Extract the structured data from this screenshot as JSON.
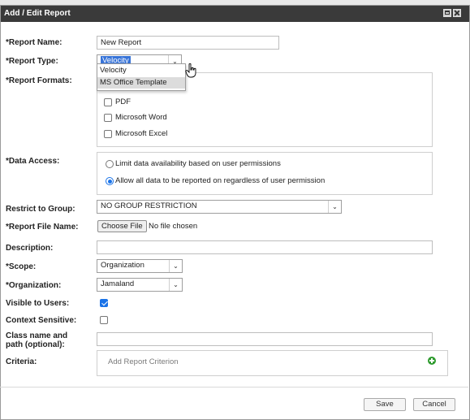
{
  "dialog": {
    "title": "Add / Edit Report"
  },
  "labels": {
    "report_name": "*Report Name:",
    "report_type": "*Report Type:",
    "report_formats": "*Report Formats:",
    "data_access": "*Data Access:",
    "restrict_group": "Restrict to Group:",
    "report_file_name": "*Report File Name:",
    "description": "Description:",
    "scope": "*Scope:",
    "organization": "*Organization:",
    "visible_users": "Visible to Users:",
    "context_sensitive": "Context Sensitive:",
    "class_name_line1": "Class name and",
    "class_name_line2": "path (optional):",
    "criteria": "Criteria:"
  },
  "fields": {
    "report_name_value": "New Report",
    "report_type_value": "Velocity",
    "report_type_options": [
      "Velocity",
      "MS Office Template"
    ],
    "formats": [
      "PDF",
      "Microsoft Word",
      "Microsoft Excel"
    ],
    "data_access_options": [
      "Limit data availability based on user permissions",
      "Allow all data to be reported on regardless of user permission"
    ],
    "restrict_group_value": "NO GROUP RESTRICTION",
    "choose_file_label": "Choose File",
    "no_file_text": "No file chosen",
    "description_value": "",
    "scope_value": "Organization",
    "organization_value": "Jamaland",
    "class_name_value": "",
    "add_criterion_label": "Add Report Criterion"
  },
  "footer": {
    "save_label": "Save",
    "cancel_label": "Cancel"
  },
  "colors": {
    "titlebar": "#3a3a3a",
    "accent": "#1a73e8",
    "add_icon": "#2e9b2e"
  }
}
